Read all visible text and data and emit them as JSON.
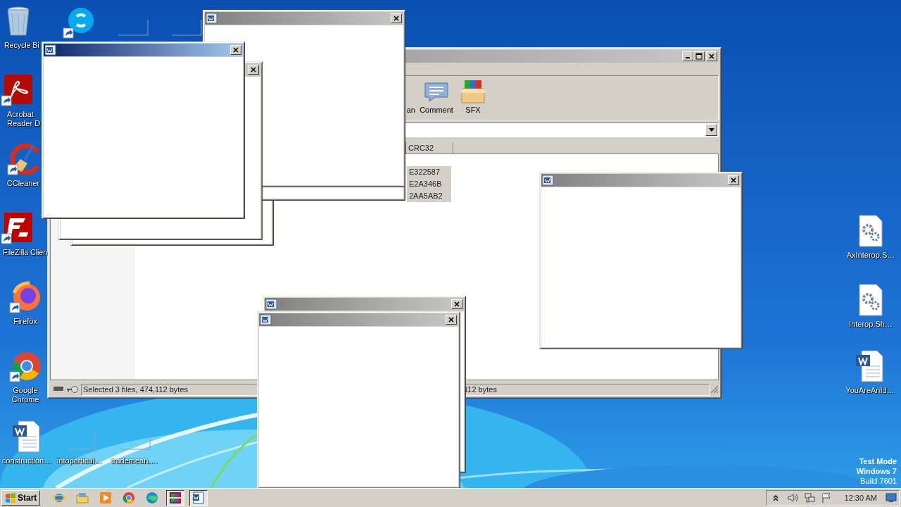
{
  "desktop_icons": [
    {
      "kind": "recycle-bin",
      "label": "Recycle Bi"
    },
    {
      "kind": "skype"
    },
    {
      "kind": "blank"
    },
    {
      "kind": "blank"
    },
    {
      "kind": "acrobat",
      "label": "Acrobat Reader D"
    },
    {
      "kind": "ccleaner",
      "label": "CCleaner"
    },
    {
      "kind": "filezilla",
      "label": "FileZilla Clien"
    },
    {
      "kind": "firefox",
      "label": "Firefox"
    },
    {
      "kind": "chrome",
      "label": "Google Chrome"
    },
    {
      "kind": "word-doc",
      "label": "construction…"
    },
    {
      "kind": "blank",
      "label": "intoparticul…"
    },
    {
      "kind": "blank",
      "label": "trademean.…"
    },
    {
      "kind": "config-file",
      "label": "AxInterop.S…"
    },
    {
      "kind": "config-file",
      "label": "Interop.Sh…"
    },
    {
      "kind": "word-doc",
      "label": "YouAreAnId…"
    }
  ],
  "archive_window": {
    "active": false,
    "toolbar": [
      {
        "kind": "partial",
        "label": "an"
      },
      {
        "kind": "comment",
        "label": "Comment"
      },
      {
        "kind": "sfx",
        "label": "SFX"
      }
    ],
    "columns": [
      "CRC32"
    ],
    "rows": [
      {
        "crc32": "E322587",
        "selected": true
      },
      {
        "crc32": "E2A346B",
        "selected": true
      },
      {
        "crc32": "2AA5AB2",
        "selected": true
      }
    ],
    "status": "Selected 3 files, 474,112 bytes",
    "status_2": "112 bytes"
  },
  "popup_windows": [
    {
      "kind": "frame"
    },
    {
      "kind": "frame"
    },
    {
      "kind": "blank",
      "active": false
    },
    {
      "kind": "blank",
      "active": false
    },
    {
      "kind": "blank",
      "active": true
    },
    {
      "kind": "blank",
      "active": false
    },
    {
      "kind": "blank",
      "active": false
    },
    {
      "kind": "blank",
      "active": false
    }
  ],
  "os_badge": [
    "Test Mode",
    "Windows 7",
    "Build 7601"
  ],
  "taskbar": {
    "start": "Start",
    "apps": [
      {
        "kind": "ie",
        "selected": false
      },
      {
        "kind": "explorer",
        "selected": false
      },
      {
        "kind": "media",
        "selected": false
      },
      {
        "kind": "chrome",
        "selected": false
      },
      {
        "kind": "edge",
        "selected": false
      },
      {
        "kind": "winrar",
        "selected": true
      },
      {
        "kind": "word",
        "selected": true
      }
    ],
    "tray": [
      {
        "kind": "chevron"
      },
      {
        "kind": "speaker"
      },
      {
        "kind": "network"
      },
      {
        "kind": "flag"
      }
    ],
    "clock": "12:30 AM"
  }
}
